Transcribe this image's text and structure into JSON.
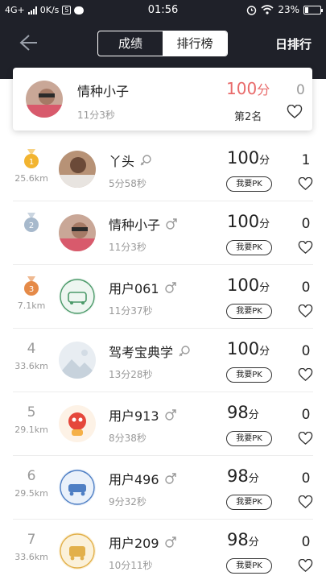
{
  "status_bar": {
    "network": "4G+",
    "speed": "0K/s",
    "time": "01:56",
    "battery": "23%",
    "icons": [
      "signal-icon",
      "data-saver-icon",
      "message-icon",
      "alarm-icon",
      "wifi-icon",
      "battery-icon"
    ]
  },
  "header": {
    "tabs": [
      {
        "label": "成绩",
        "active": false
      },
      {
        "label": "排行榜",
        "active": true
      }
    ],
    "period_label": "日排行",
    "icons": [
      "back-arrow-icon"
    ]
  },
  "my_entry": {
    "name": "情种小子",
    "time": "11分3秒",
    "score": "100",
    "score_unit": "分",
    "rank_text": "第2名",
    "likes": "0",
    "score_color": "#e86a6a"
  },
  "ranking": [
    {
      "rank": "1",
      "medal": "gold",
      "distance": "25.6km",
      "name": "丫头",
      "gender": "female",
      "time": "5分58秒",
      "score": "100",
      "likes": "1",
      "avatar": "photo-girl"
    },
    {
      "rank": "2",
      "medal": "silver",
      "distance": "",
      "name": "情种小子",
      "gender": "male",
      "time": "11分3秒",
      "score": "100",
      "likes": "0",
      "avatar": "photo-guy"
    },
    {
      "rank": "3",
      "medal": "bronze",
      "distance": "7.1km",
      "name": "用户061",
      "gender": "male",
      "time": "11分37秒",
      "score": "100",
      "likes": "0",
      "avatar": "car-green"
    },
    {
      "rank": "4",
      "medal": "",
      "distance": "33.6km",
      "name": "驾考宝典学",
      "gender": "female",
      "time": "13分28秒",
      "score": "100",
      "likes": "0",
      "avatar": "image-placeholder"
    },
    {
      "rank": "5",
      "medal": "",
      "distance": "29.1km",
      "name": "用户913",
      "gender": "male",
      "time": "8分38秒",
      "score": "98",
      "likes": "0",
      "avatar": "cartoon-red"
    },
    {
      "rank": "6",
      "medal": "",
      "distance": "29.5km",
      "name": "用户496",
      "gender": "male",
      "time": "9分32秒",
      "score": "98",
      "likes": "0",
      "avatar": "car-blue"
    },
    {
      "rank": "7",
      "medal": "",
      "distance": "33.6km",
      "name": "用户209",
      "gender": "male",
      "time": "10分11秒",
      "score": "98",
      "likes": "0",
      "avatar": "car-yellow"
    }
  ],
  "labels": {
    "score_unit": "分",
    "pk_button": "我要PK"
  },
  "colors": {
    "header_bg": "#1f2129",
    "score_highlight": "#e86a6a",
    "medal_gold": "#f2b430",
    "medal_silver": "#a7b9cc",
    "medal_bronze": "#e58a48"
  }
}
